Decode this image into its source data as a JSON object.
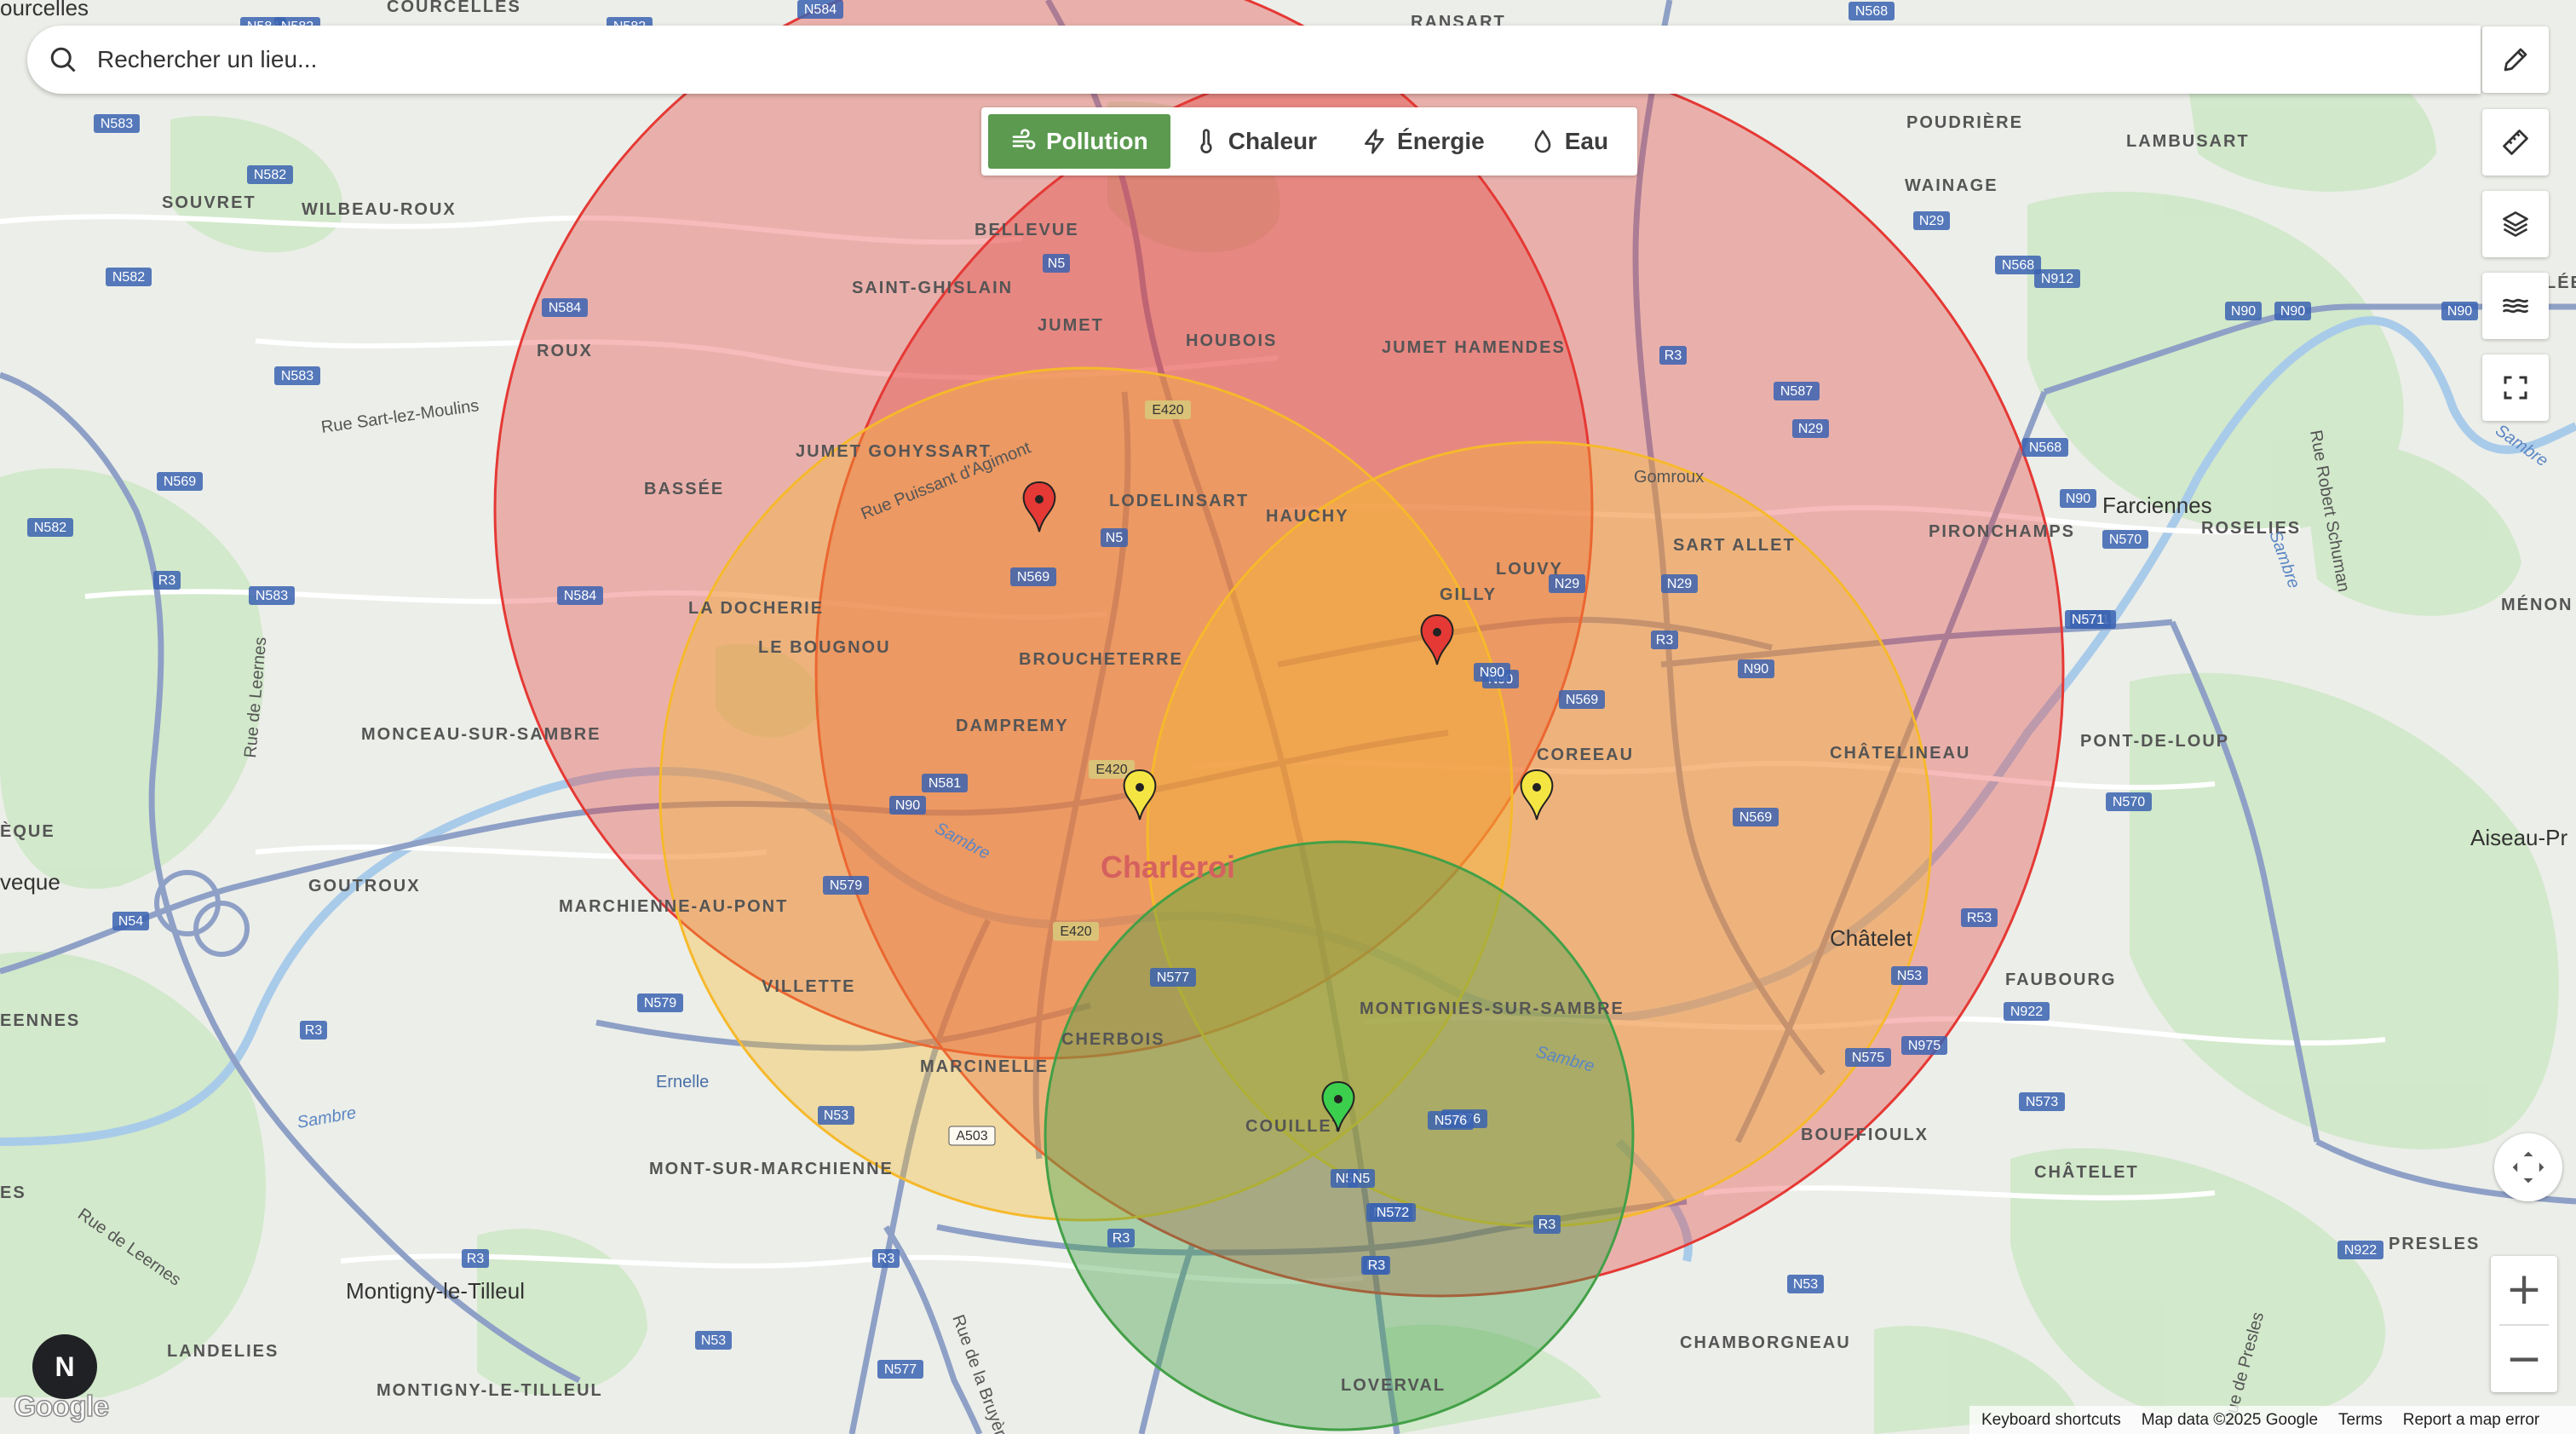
{
  "search": {
    "placeholder": "Rechercher un lieu..."
  },
  "filters": [
    {
      "label": "Pollution",
      "icon": "wind-icon",
      "active": true
    },
    {
      "label": "Chaleur",
      "icon": "thermometer-icon",
      "active": false
    },
    {
      "label": "Énergie",
      "icon": "bolt-icon",
      "active": false
    },
    {
      "label": "Eau",
      "icon": "droplet-icon",
      "active": false
    }
  ],
  "tools": [
    {
      "name": "edit-tool-button",
      "icon": "pencil-icon"
    },
    {
      "name": "measure-tool-button",
      "icon": "ruler-icon"
    },
    {
      "name": "layers-tool-button",
      "icon": "layers-icon"
    },
    {
      "name": "heat-tool-button",
      "icon": "waves-icon"
    },
    {
      "name": "fullscreen-button",
      "icon": "fullscreen-icon"
    }
  ],
  "zones": [
    {
      "level": "high",
      "color": "#e53935"
    },
    {
      "level": "high",
      "color": "#e53935"
    },
    {
      "level": "medium",
      "color": "#f6b92b"
    },
    {
      "level": "medium",
      "color": "#f6b92b"
    },
    {
      "level": "low",
      "color": "#43a047"
    }
  ],
  "markers": [
    {
      "color": "#e53935"
    },
    {
      "color": "#e53935"
    },
    {
      "color": "#f4e542"
    },
    {
      "color": "#f4e542"
    },
    {
      "color": "#3ccf4e"
    }
  ],
  "map_labels": {
    "charleroi": "Charleroi",
    "farciennes": "Farciennes",
    "chatelet": "Châtelet",
    "montigny_le_tilleul": "Montigny-le-Tilleul",
    "aiseau": "Aiseau-Pr",
    "marchienne": "MARCHIENNE-AU-PONT",
    "montignies": "MONTIGNIES-SUR-SAMBRE",
    "couillet": "COUILLET",
    "gilly": "GILLY",
    "jumet": "JUMET",
    "jumet_gohyssart": "JUMET GOHYSSART",
    "jumet_hamendes": "JUMET HAMENDES",
    "lodelinsart": "LODELINSART",
    "dampremy": "DAMPREMY",
    "broucheterre": "BROUCHETERRE",
    "hauchy": "HAUCHY",
    "louvy": "LOUVY",
    "sart_allet": "SART ALLET",
    "coreeau": "COREEAU",
    "chatelineau": "CHÂTELINEAU",
    "pironchamps": "PIRONCHAMPS",
    "poudriere": "POUDRIÈRE",
    "wainage": "WAINAGE",
    "lambusart": "LAMBUSART",
    "bellevue": "BELLEVUE",
    "saint_ghislain": "SAINT-GHISLAIN",
    "houbois": "HOUBOIS",
    "wilbeau_roux": "WILBEAU-ROUX",
    "souvret": "SOUVRET",
    "roux": "ROUX",
    "bassee": "BASSÉE",
    "la_docherie": "LA DOCHERIE",
    "le_bougnou": "LE BOUGNOU",
    "monceau": "MONCEAU-SUR-SAMBRE",
    "goutroux": "GOUTROUX",
    "villette": "VILLETTE",
    "cherbois": "CHERBOIS",
    "marcinelle": "MARCINELLE",
    "mont_sur_marchienne": "MONT-SUR-MARCHIENNE",
    "ernelle": "Ernelle",
    "landelies": "LANDELIES",
    "montigny_small": "MONTIGNY-LE-TILLEUL",
    "loverval": "LOVERVAL",
    "chamborgneau": "CHAMBORGNEAU",
    "bouffioulx": "BOUFFIOULX",
    "chatelet_small": "CHÂTELET",
    "faubourg": "FAUBOURG",
    "pont_de_loup": "PONT-DE-LOUP",
    "roselies": "ROSELIES",
    "menon": "MÉNON",
    "presles": "PRESLES",
    "eennes": "EENNES",
    "es": "ES",
    "eque": "ÈQUE",
    "veque": "veque",
    "courcelles": "ourcelles",
    "courcelles_small": "COURCELLES",
    "ransart": "RANSART",
    "rue_sart": "Rue Sart-lez-Moulins",
    "rue_puissant": "Rue Puissant d'Agimont",
    "rue_leernes": "Rue de Leernes",
    "rue_leernes2": "Rue de Leernes",
    "rue_bruyere": "Rue de la Bruyère",
    "rue_schuman": "Rue Robert Schuman",
    "rue_presles": "Rue de Presles",
    "sambre1": "Sambre",
    "sambre2": "Sambre",
    "sambre3": "Sambre",
    "sambre4": "Sambre",
    "sambre5": "Sambre",
    "gomroux": "Gomroux",
    "lee": "LÉE"
  },
  "road_shields": [
    "N584",
    "N582",
    "N583",
    "N582",
    "N582",
    "N584",
    "N583",
    "N569",
    "N582",
    "R3",
    "N583",
    "N584",
    "N5",
    "E420",
    "N5",
    "N569",
    "N29",
    "N90",
    "N581",
    "N90",
    "E420",
    "N579",
    "E420",
    "N577",
    "N53",
    "A503",
    "R3",
    "R3",
    "R3",
    "N53",
    "N577",
    "N579",
    "R3",
    "N5",
    "N572",
    "R3",
    "R3",
    "N53",
    "N576",
    "N575",
    "N975",
    "N573",
    "N922",
    "N922",
    "N53",
    "R53",
    "N570",
    "N571",
    "N90",
    "N569",
    "N29",
    "N90",
    "N29",
    "R3",
    "N587",
    "R3",
    "N29",
    "N90",
    "N568",
    "N912",
    "N90",
    "N568",
    "N90",
    "N570",
    "N571",
    "N584",
    "N582",
    "N568",
    "N584",
    "N572",
    "N569",
    "N90",
    "N576",
    "N5",
    "R3",
    "N54"
  ],
  "attribution": {
    "keyboard": "Keyboard shortcuts",
    "map_data": "Map data ©2025 Google",
    "terms": "Terms",
    "report": "Report a map error"
  },
  "compass_label": "N",
  "google_logo": "Google",
  "zoom": {
    "in": "+",
    "out": "−"
  }
}
